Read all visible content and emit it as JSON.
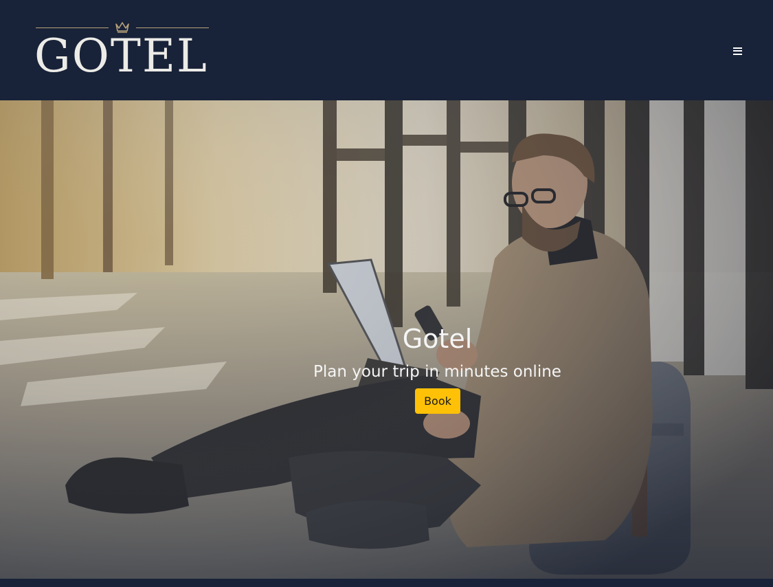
{
  "brand": {
    "logo_text": "Gotel",
    "crown_icon": "crown-icon"
  },
  "navbar": {
    "menu_icon": "hamburger-menu-icon"
  },
  "hero": {
    "title": "Gotel",
    "subtitle": "Plan your trip in minutes online",
    "book_label": "Book",
    "image": "man-with-laptop-photo"
  },
  "colors": {
    "navbar_bg": "#182238",
    "logo_text": "#ecebe7",
    "logo_gold": "#b9a37b",
    "button_bg": "#ffc107"
  }
}
